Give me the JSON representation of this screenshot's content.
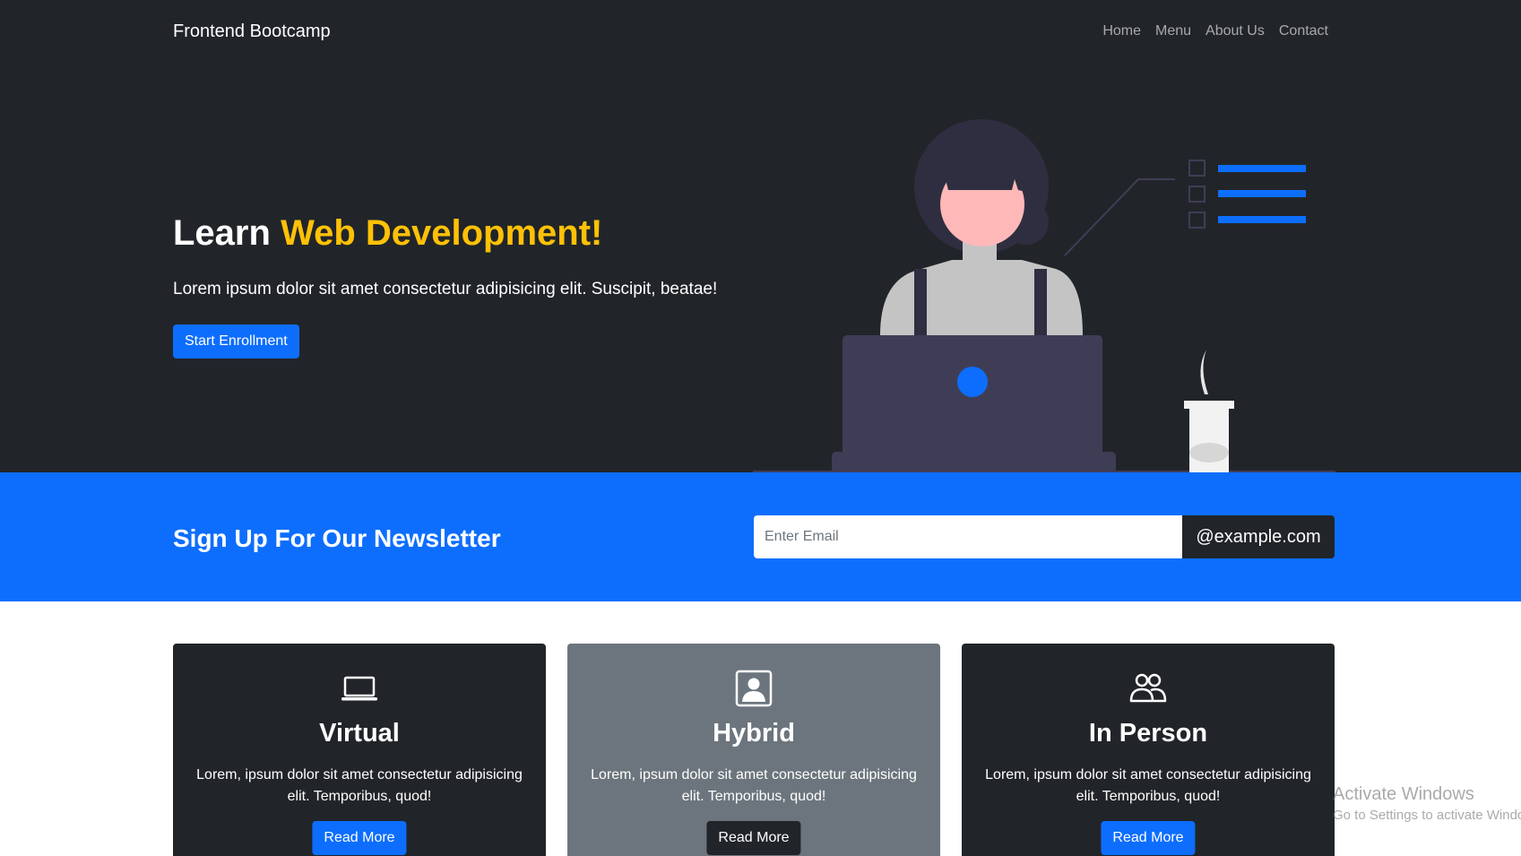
{
  "navbar": {
    "brand": "Frontend Bootcamp",
    "links": [
      "Home",
      "Menu",
      "About Us",
      "Contact"
    ]
  },
  "hero": {
    "title_prefix": "Learn",
    "title_accent": "Web Development!",
    "lead": "Lorem ipsum dolor sit amet consectetur adipisicing elit. Suscipit, beatae!",
    "button_label": "Start Enrollment"
  },
  "newsletter": {
    "title": "Sign Up For Our Newsletter",
    "email_placeholder": "Enter Email",
    "email_value": "",
    "addon": "@example.com"
  },
  "cards": [
    {
      "icon": "laptop-icon",
      "title": "Virtual",
      "text": "Lorem, ipsum dolor sit amet consectetur adipisicing elit. Temporibus, quod!",
      "button": "Read More"
    },
    {
      "icon": "person-badge-icon",
      "title": "Hybrid",
      "text": "Lorem, ipsum dolor sit amet consectetur adipisicing elit. Temporibus, quod!",
      "button": "Read More"
    },
    {
      "icon": "people-icon",
      "title": "In Person",
      "text": "Lorem, ipsum dolor sit amet consectetur adipisicing elit. Temporibus, quod!",
      "button": "Read More"
    }
  ],
  "watermark": {
    "title": "Activate Windows",
    "subtitle": "Go to Settings to activate Windows."
  },
  "colors": {
    "dark": "#212529",
    "primary": "#0d6efd",
    "accent": "#ffc107",
    "gray": "#6c757d"
  }
}
